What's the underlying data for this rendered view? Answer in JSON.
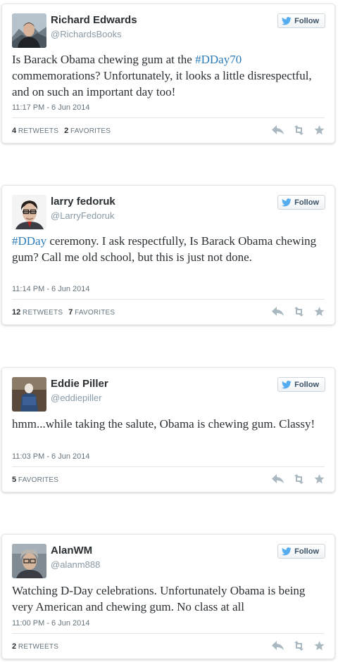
{
  "follow_label": "Follow",
  "colors": {
    "hashtag": "#2b7bb9",
    "twitter_bird": "#55acee",
    "name": "#292f33",
    "meta": "#8899a6",
    "action_icons": "#aab8c2"
  },
  "icons": {
    "follow": "twitter-bird-icon",
    "reply": "reply-icon",
    "retweet": "retweet-icon",
    "favorite": "star-icon"
  },
  "tweets": [
    {
      "name": "Richard Edwards",
      "handle": "@RichardsBooks",
      "text_before": "Is Barack Obama chewing gum at the ",
      "hashtag": "#DDay70",
      "text_after": " commemorations? Unfortunately, it looks a little disrespectful, and on such an important day too!",
      "timestamp": "11:17 PM - 6 Jun 2014",
      "retweets_count": "4",
      "retweets_label": "Retweets",
      "favorites_count": "2",
      "favorites_label": "Favorites"
    },
    {
      "name": "larry fedoruk",
      "handle": "@LarryFedoruk",
      "text_before": "",
      "hashtag": "#DDay",
      "text_after": " ceremony. I ask respectfully, Is Barack Obama chewing gum? Call me old school, but this is just not done.",
      "timestamp": "11:14 PM - 6 Jun 2014",
      "retweets_count": "12",
      "retweets_label": "Retweets",
      "favorites_count": "7",
      "favorites_label": "Favorites"
    },
    {
      "name": "Eddie Piller",
      "handle": "@eddiepiller",
      "text": "hmm...while taking the salute, Obama is chewing gum. Classy!",
      "timestamp": "11:03 PM - 6 Jun 2014",
      "favorites_count": "5",
      "favorites_label": "Favorites"
    },
    {
      "name": "AlanWM",
      "handle": "@alanm888",
      "text": "Watching D-Day celebrations. Unfortunately Obama is being very American and chewing gum. No class at all",
      "timestamp": "11:00 PM - 6 Jun 2014",
      "retweets_count": "2",
      "retweets_label": "Retweets"
    }
  ]
}
